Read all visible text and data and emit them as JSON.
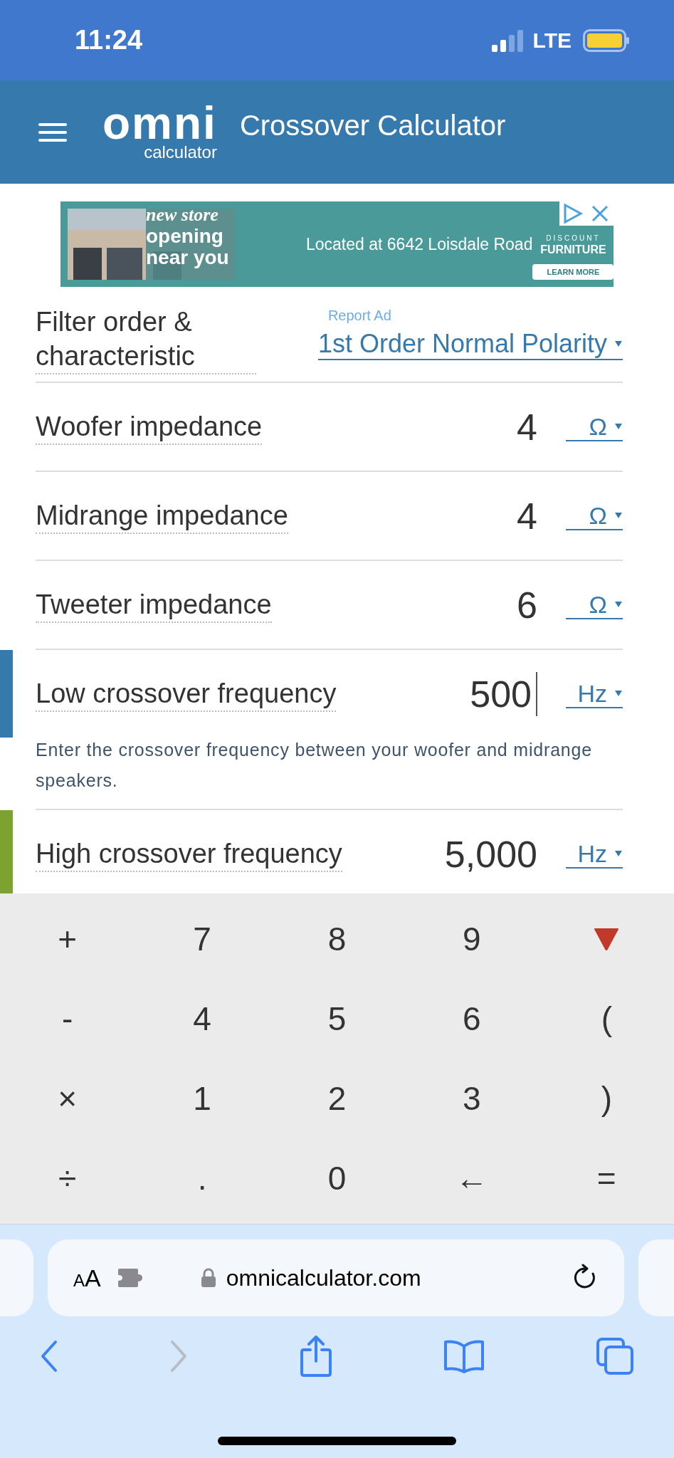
{
  "status_bar": {
    "time": "11:24",
    "network": "LTE"
  },
  "header": {
    "logo_word": "omni",
    "logo_tagline": "calculator",
    "title": "Crossover Calculator"
  },
  "ad": {
    "headline": [
      "new store",
      "opening",
      "near you"
    ],
    "text": "Located at 6642 Loisdale Road",
    "brand": [
      "DISCOUNT",
      "FURNITURE"
    ],
    "cta": "LEARN MORE",
    "report": "Report Ad"
  },
  "fields": [
    {
      "kind": "select",
      "label": "Filter order & characteristic",
      "value": "1st Order Normal Polarity",
      "focused": false
    },
    {
      "kind": "number",
      "label": "Woofer impedance",
      "value": "4",
      "unit": "Ω",
      "focused": false
    },
    {
      "kind": "number",
      "label": "Midrange impedance",
      "value": "4",
      "unit": "Ω",
      "focused": false
    },
    {
      "kind": "number",
      "label": "Tweeter impedance",
      "value": "6",
      "unit": "Ω",
      "focused": false
    },
    {
      "kind": "number",
      "label": "Low crossover frequency",
      "value": "500",
      "unit": "Hz",
      "color": "#3579ad",
      "focused": true,
      "hint": "Enter the crossover frequency between your woofer and midrange speakers."
    },
    {
      "kind": "number",
      "label": "High crossover frequency",
      "value": "5,000",
      "unit": "Hz",
      "color": "#7ca22f",
      "focused": false
    }
  ],
  "keypad": [
    {
      "kind": "key",
      "label": "+"
    },
    {
      "kind": "key",
      "label": "7"
    },
    {
      "kind": "key",
      "label": "8"
    },
    {
      "kind": "key",
      "label": "9"
    },
    {
      "kind": "hide"
    },
    {
      "kind": "key",
      "label": "-"
    },
    {
      "kind": "key",
      "label": "4"
    },
    {
      "kind": "key",
      "label": "5"
    },
    {
      "kind": "key",
      "label": "6"
    },
    {
      "kind": "key",
      "label": "("
    },
    {
      "kind": "key",
      "label": "×"
    },
    {
      "kind": "key",
      "label": "1"
    },
    {
      "kind": "key",
      "label": "2"
    },
    {
      "kind": "key",
      "label": "3"
    },
    {
      "kind": "key",
      "label": ")"
    },
    {
      "kind": "key",
      "label": "÷"
    },
    {
      "kind": "key",
      "label": "."
    },
    {
      "kind": "key",
      "label": "0"
    },
    {
      "kind": "key",
      "label": "←"
    },
    {
      "kind": "key",
      "label": "="
    }
  ],
  "browser": {
    "text_size": "AA",
    "url": "omnicalculator.com",
    "forward_enabled": false
  }
}
